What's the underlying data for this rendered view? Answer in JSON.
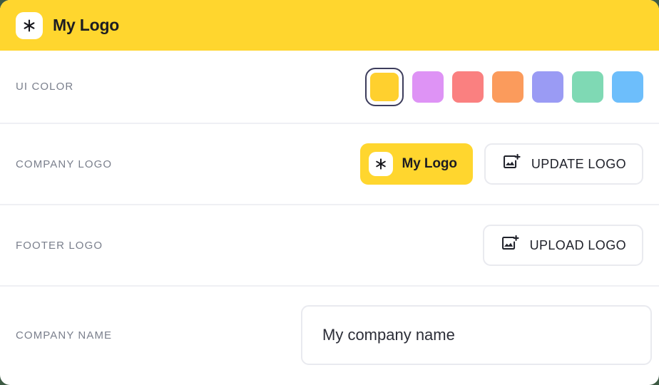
{
  "header": {
    "brand_name": "My Logo",
    "logo_glyph": "asterisk-icon",
    "background_color": "#FFD62E"
  },
  "rows": {
    "ui_color": {
      "label": "UI COLOR",
      "selected_index": 0,
      "selection_ring_color": "#3d3d5c",
      "swatches": [
        {
          "name": "yellow",
          "color": "#FFD02E"
        },
        {
          "name": "violet",
          "color": "#DE93F5"
        },
        {
          "name": "red",
          "color": "#FA8080"
        },
        {
          "name": "orange",
          "color": "#FB9B5C"
        },
        {
          "name": "indigo",
          "color": "#9A9BF4"
        },
        {
          "name": "green",
          "color": "#7FD9B4"
        },
        {
          "name": "blue",
          "color": "#6DBEFB"
        }
      ]
    },
    "company_logo": {
      "label": "COMPANY LOGO",
      "preview_label": "My Logo",
      "preview_glyph": "asterisk-icon",
      "update_label": "UPDATE LOGO",
      "update_icon": "add-image-icon"
    },
    "footer_logo": {
      "label": "FOOTER LOGO",
      "upload_label": "UPLOAD LOGO",
      "upload_icon": "add-image-icon"
    },
    "company_name": {
      "label": "COMPANY NAME",
      "value": "My company name",
      "placeholder": "My company name"
    }
  }
}
